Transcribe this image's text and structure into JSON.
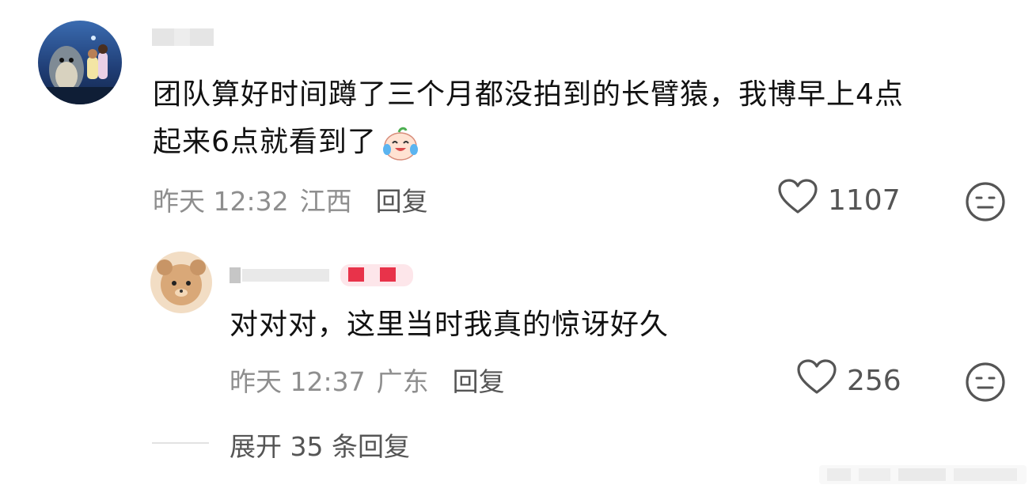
{
  "main_comment": {
    "text_line1": "团队算好时间蹲了三个月都没拍到的长臂猿，我博早上4点",
    "text_line2": "起来6点就看到了",
    "time": "昨天 12:32",
    "location": "江西",
    "reply_label": "回复",
    "like_count": "1107",
    "emoji": "laughing-tears-emoji"
  },
  "reply_comment": {
    "text": "对对对，这里当时我真的惊讶好久",
    "time": "昨天 12:37",
    "location": "广东",
    "reply_label": "回复",
    "like_count": "256"
  },
  "expand": {
    "label": "展开 35 条回复"
  },
  "icons": {
    "like": "heart-outline-icon",
    "dislike": "neutral-face-icon"
  },
  "colors": {
    "text_primary": "#111111",
    "text_meta": "#8e8e8e",
    "text_action": "#555555",
    "badge_red": "#e8334a"
  }
}
